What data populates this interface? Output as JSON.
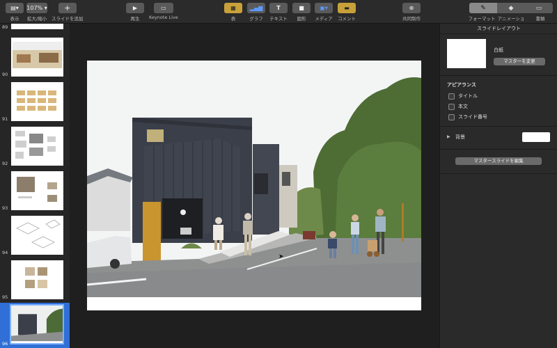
{
  "toolbar": {
    "view_label": "表示",
    "zoom_value": "107%",
    "zoom_label": "拡大/縮小",
    "add_slide_label": "スライドを追加",
    "play_label": "再生",
    "keynote_live_label": "Keynote Live",
    "table_label": "表",
    "chart_label": "グラフ",
    "text_label": "テキスト",
    "shape_label": "図形",
    "media_label": "メディア",
    "comment_label": "コメント",
    "collaborate_label": "共同制作",
    "format_label": "フォーマット",
    "animate_label": "アニメーション",
    "document_label": "書類"
  },
  "navigator": {
    "slides": [
      {
        "num": "89"
      },
      {
        "num": "90"
      },
      {
        "num": "91"
      },
      {
        "num": "92"
      },
      {
        "num": "93"
      },
      {
        "num": "94"
      },
      {
        "num": "95"
      },
      {
        "num": "96",
        "selected": true
      }
    ]
  },
  "inspector": {
    "title": "スライドレイアウト",
    "master_name": "白紙",
    "change_master_label": "マスターを変更",
    "appearance_heading": "アピアランス",
    "checkbox_title": "タイトル",
    "checkbox_body": "本文",
    "checkbox_slide_number": "スライド番号",
    "background_label": "背景",
    "edit_master_label": "マスタースライドを編集"
  },
  "colors": {
    "selection": "#2f6fd6",
    "house_siding": "#3b3f4a",
    "door": "#c9952e"
  }
}
